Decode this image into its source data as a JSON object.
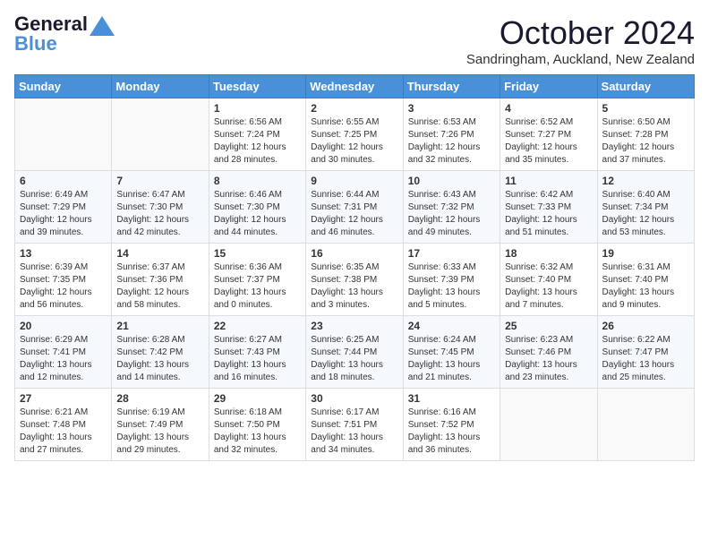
{
  "header": {
    "logo_general": "General",
    "logo_blue": "Blue",
    "month_title": "October 2024",
    "location": "Sandringham, Auckland, New Zealand"
  },
  "days_of_week": [
    "Sunday",
    "Monday",
    "Tuesday",
    "Wednesday",
    "Thursday",
    "Friday",
    "Saturday"
  ],
  "weeks": [
    [
      {
        "day": "",
        "info": ""
      },
      {
        "day": "",
        "info": ""
      },
      {
        "day": "1",
        "info": "Sunrise: 6:56 AM\nSunset: 7:24 PM\nDaylight: 12 hours and 28 minutes."
      },
      {
        "day": "2",
        "info": "Sunrise: 6:55 AM\nSunset: 7:25 PM\nDaylight: 12 hours and 30 minutes."
      },
      {
        "day": "3",
        "info": "Sunrise: 6:53 AM\nSunset: 7:26 PM\nDaylight: 12 hours and 32 minutes."
      },
      {
        "day": "4",
        "info": "Sunrise: 6:52 AM\nSunset: 7:27 PM\nDaylight: 12 hours and 35 minutes."
      },
      {
        "day": "5",
        "info": "Sunrise: 6:50 AM\nSunset: 7:28 PM\nDaylight: 12 hours and 37 minutes."
      }
    ],
    [
      {
        "day": "6",
        "info": "Sunrise: 6:49 AM\nSunset: 7:29 PM\nDaylight: 12 hours and 39 minutes."
      },
      {
        "day": "7",
        "info": "Sunrise: 6:47 AM\nSunset: 7:30 PM\nDaylight: 12 hours and 42 minutes."
      },
      {
        "day": "8",
        "info": "Sunrise: 6:46 AM\nSunset: 7:30 PM\nDaylight: 12 hours and 44 minutes."
      },
      {
        "day": "9",
        "info": "Sunrise: 6:44 AM\nSunset: 7:31 PM\nDaylight: 12 hours and 46 minutes."
      },
      {
        "day": "10",
        "info": "Sunrise: 6:43 AM\nSunset: 7:32 PM\nDaylight: 12 hours and 49 minutes."
      },
      {
        "day": "11",
        "info": "Sunrise: 6:42 AM\nSunset: 7:33 PM\nDaylight: 12 hours and 51 minutes."
      },
      {
        "day": "12",
        "info": "Sunrise: 6:40 AM\nSunset: 7:34 PM\nDaylight: 12 hours and 53 minutes."
      }
    ],
    [
      {
        "day": "13",
        "info": "Sunrise: 6:39 AM\nSunset: 7:35 PM\nDaylight: 12 hours and 56 minutes."
      },
      {
        "day": "14",
        "info": "Sunrise: 6:37 AM\nSunset: 7:36 PM\nDaylight: 12 hours and 58 minutes."
      },
      {
        "day": "15",
        "info": "Sunrise: 6:36 AM\nSunset: 7:37 PM\nDaylight: 13 hours and 0 minutes."
      },
      {
        "day": "16",
        "info": "Sunrise: 6:35 AM\nSunset: 7:38 PM\nDaylight: 13 hours and 3 minutes."
      },
      {
        "day": "17",
        "info": "Sunrise: 6:33 AM\nSunset: 7:39 PM\nDaylight: 13 hours and 5 minutes."
      },
      {
        "day": "18",
        "info": "Sunrise: 6:32 AM\nSunset: 7:40 PM\nDaylight: 13 hours and 7 minutes."
      },
      {
        "day": "19",
        "info": "Sunrise: 6:31 AM\nSunset: 7:40 PM\nDaylight: 13 hours and 9 minutes."
      }
    ],
    [
      {
        "day": "20",
        "info": "Sunrise: 6:29 AM\nSunset: 7:41 PM\nDaylight: 13 hours and 12 minutes."
      },
      {
        "day": "21",
        "info": "Sunrise: 6:28 AM\nSunset: 7:42 PM\nDaylight: 13 hours and 14 minutes."
      },
      {
        "day": "22",
        "info": "Sunrise: 6:27 AM\nSunset: 7:43 PM\nDaylight: 13 hours and 16 minutes."
      },
      {
        "day": "23",
        "info": "Sunrise: 6:25 AM\nSunset: 7:44 PM\nDaylight: 13 hours and 18 minutes."
      },
      {
        "day": "24",
        "info": "Sunrise: 6:24 AM\nSunset: 7:45 PM\nDaylight: 13 hours and 21 minutes."
      },
      {
        "day": "25",
        "info": "Sunrise: 6:23 AM\nSunset: 7:46 PM\nDaylight: 13 hours and 23 minutes."
      },
      {
        "day": "26",
        "info": "Sunrise: 6:22 AM\nSunset: 7:47 PM\nDaylight: 13 hours and 25 minutes."
      }
    ],
    [
      {
        "day": "27",
        "info": "Sunrise: 6:21 AM\nSunset: 7:48 PM\nDaylight: 13 hours and 27 minutes."
      },
      {
        "day": "28",
        "info": "Sunrise: 6:19 AM\nSunset: 7:49 PM\nDaylight: 13 hours and 29 minutes."
      },
      {
        "day": "29",
        "info": "Sunrise: 6:18 AM\nSunset: 7:50 PM\nDaylight: 13 hours and 32 minutes."
      },
      {
        "day": "30",
        "info": "Sunrise: 6:17 AM\nSunset: 7:51 PM\nDaylight: 13 hours and 34 minutes."
      },
      {
        "day": "31",
        "info": "Sunrise: 6:16 AM\nSunset: 7:52 PM\nDaylight: 13 hours and 36 minutes."
      },
      {
        "day": "",
        "info": ""
      },
      {
        "day": "",
        "info": ""
      }
    ]
  ]
}
